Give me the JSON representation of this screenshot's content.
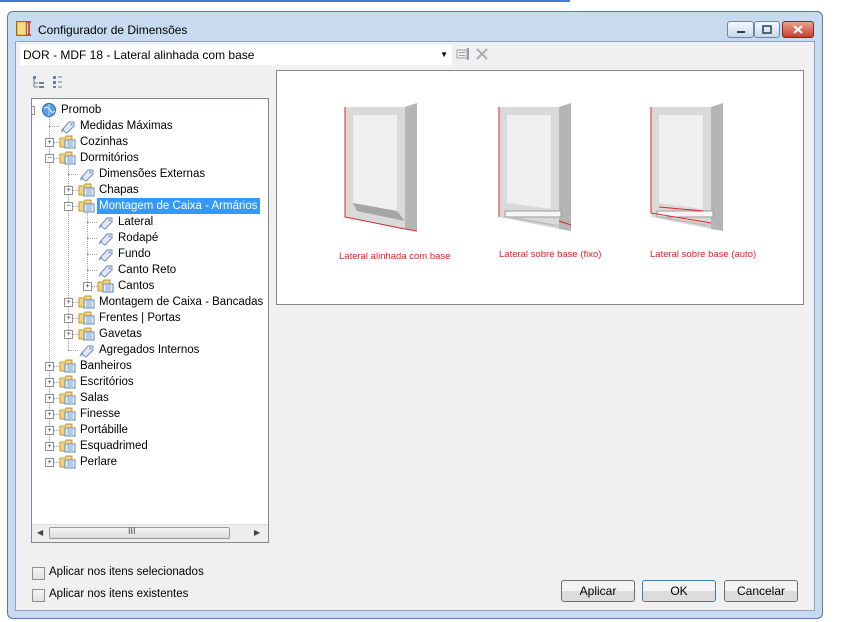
{
  "window": {
    "title": "Configurador de Dimensões"
  },
  "toolbar": {
    "combo_value": "DOR - MDF 18 - Lateral alinhada com base",
    "icons": [
      "properties-icon",
      "delete-icon"
    ]
  },
  "tree": {
    "items": [
      {
        "label": "Promob"
      },
      {
        "label": "Medidas Máximas"
      },
      {
        "label": "Cozinhas"
      },
      {
        "label": "Dormitórios"
      },
      {
        "label": "Dimensões Externas"
      },
      {
        "label": "Chapas"
      },
      {
        "label": "Montagem de Caixa - Armários"
      },
      {
        "label": "Lateral"
      },
      {
        "label": "Rodapé"
      },
      {
        "label": "Fundo"
      },
      {
        "label": "Canto Reto"
      },
      {
        "label": "Cantos"
      },
      {
        "label": "Montagem de Caixa - Bancadas"
      },
      {
        "label": "Frentes | Portas"
      },
      {
        "label": "Gavetas"
      },
      {
        "label": "Agregados Internos"
      },
      {
        "label": "Banheiros"
      },
      {
        "label": "Escritórios"
      },
      {
        "label": "Salas"
      },
      {
        "label": "Finesse"
      },
      {
        "label": "Portábille"
      },
      {
        "label": "Esquadrimed"
      },
      {
        "label": "Perlare"
      }
    ],
    "selected": "Montagem de Caixa - Armários",
    "scroll_grip": "III"
  },
  "preview": {
    "captions": [
      "Lateral alinhada com base",
      "Lateral sobre base (fixo)",
      "Lateral sobre base (auto)"
    ],
    "accent_color": "#e0262b"
  },
  "options": {
    "apply_selected": "Aplicar nos itens selecionados",
    "apply_existing": "Aplicar nos itens existentes"
  },
  "buttons": {
    "apply": "Aplicar",
    "ok": "OK",
    "cancel": "Cancelar"
  }
}
